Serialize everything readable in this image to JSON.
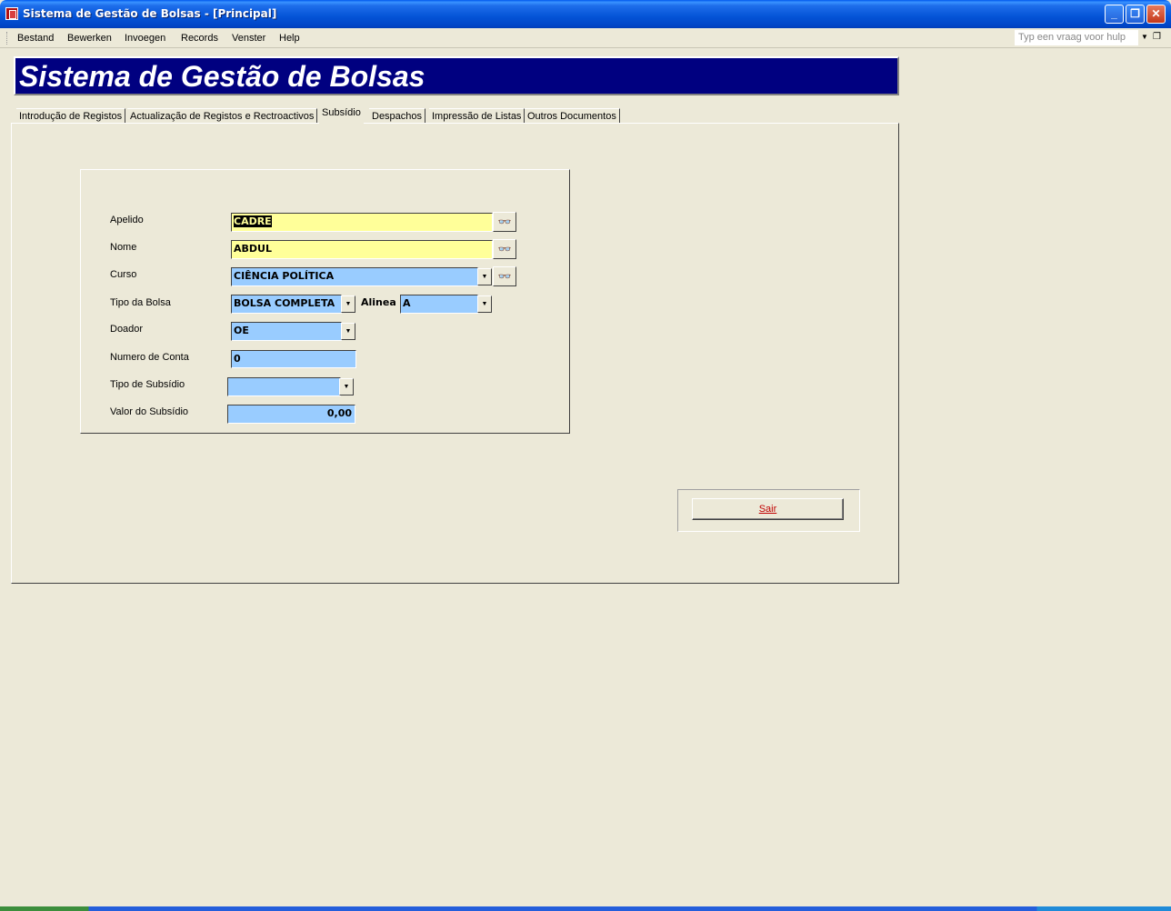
{
  "window": {
    "title": "Sistema de Gestão de Bolsas - [Principal]",
    "buttons": [
      "_",
      "❐",
      "✕"
    ]
  },
  "menu": {
    "items": [
      "Bestand",
      "Bewerken",
      "Invoegen",
      "Records",
      "Venster",
      "Help"
    ],
    "help_placeholder": "Typ een vraag voor hulp"
  },
  "banner": {
    "title": "Sistema de Gestão de Bolsas"
  },
  "tabs": [
    "Introdução de Registos",
    "Actualização de Registos e  Rectroactivos",
    "Subsídio",
    "Despachos",
    "Impressão de Listas",
    "Outros Documentos"
  ],
  "active_tab": "Subsídio",
  "form": {
    "apelido_label": "Apelido",
    "apelido_value": "CADRE",
    "nome_label": "Nome",
    "nome_value": "ABDUL",
    "curso_label": "Curso",
    "curso_value": "CIÊNCIA POLÍTICA",
    "tipo_bolsa_label": "Tipo da Bolsa",
    "tipo_bolsa_value": "BOLSA COMPLETA",
    "alinea_label": "Alinea",
    "alinea_value": "A",
    "doador_label": "Doador",
    "doador_value": "OE",
    "numero_conta_label": "Numero de Conta",
    "numero_conta_value": "0",
    "tipo_subsidio_label": "Tipo de Subsídio",
    "tipo_subsidio_value": "",
    "valor_subsidio_label": "Valor do Subsídio",
    "valor_subsidio_value": "0,00"
  },
  "exit_button": {
    "label": "Sair"
  },
  "icons": {
    "find": "binoculars-icon",
    "dropdown": "chevron-down-icon",
    "app": "access-form-icon"
  },
  "colors": {
    "titlebar": "#0453D6",
    "banner": "#000080",
    "field_yellow": "#FFFF99",
    "field_blue": "#99CCFF",
    "background": "#ECE9D8"
  }
}
